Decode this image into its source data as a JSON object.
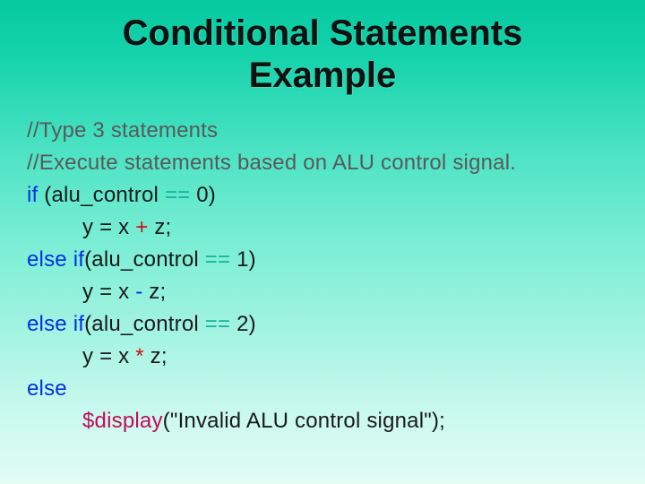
{
  "title_line1": "Conditional Statements",
  "title_line2": "Example",
  "code": {
    "c1": "//Type 3 statements",
    "c2": "//Execute statements based on ALU control signal.",
    "kw_if": "if",
    "kw_else": "else",
    "cond0_a": " (alu_control ",
    "opeq": "==",
    "cond0_b": " 0)",
    "body0_a": "y = x ",
    "plus": "+",
    "body0_b": " z;",
    "cond1_a": "(alu_control ",
    "cond1_b": " 1)",
    "body1_a": "y = x ",
    "minus": "-",
    "body1_b": " z;",
    "cond2_a": "(alu_control ",
    "cond2_b": " 2)",
    "body2_a": "y = x ",
    "mul": "*",
    "body2_b": " z;",
    "sys_display": "$display",
    "disp_arg": "(\"Invalid ALU control signal\");",
    "sp": " "
  }
}
